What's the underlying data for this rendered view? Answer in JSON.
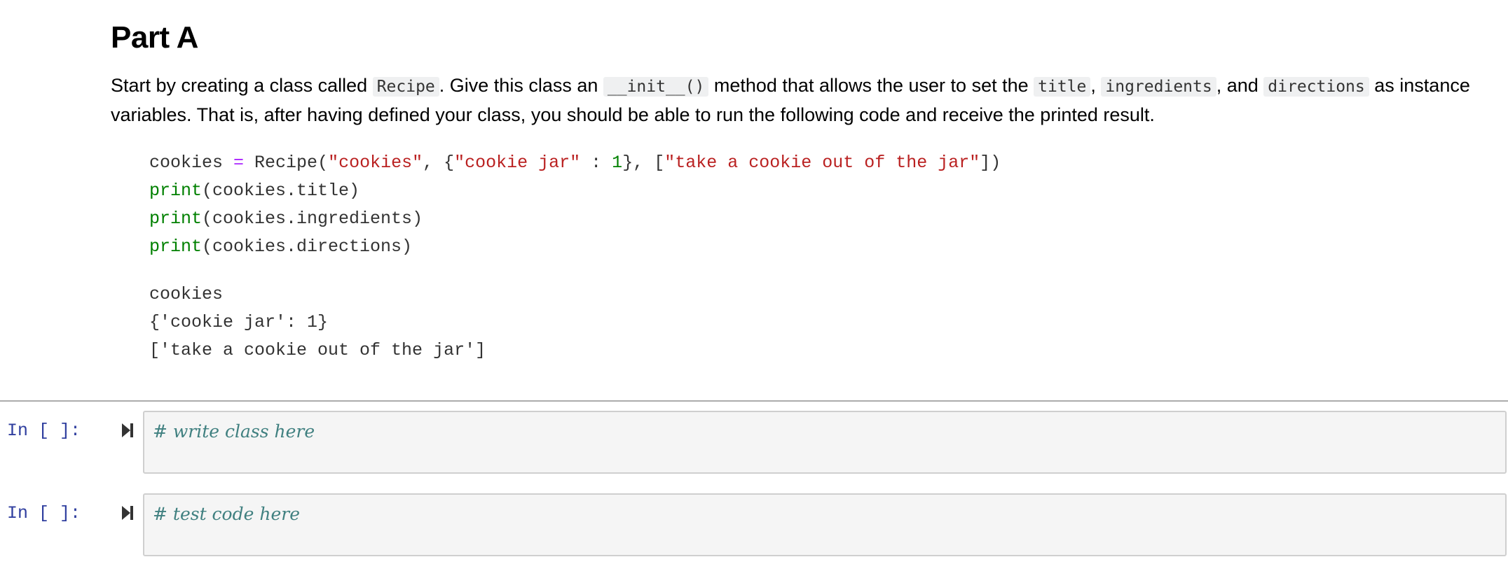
{
  "markdown": {
    "title": "Part A",
    "instructions": {
      "t1": "Start by creating a class called ",
      "c1": "Recipe",
      "t2": ". Give this class an ",
      "c2": "__init__()",
      "t3": " method that allows the user to set the ",
      "c3": "title",
      "t4": ", ",
      "c4": "ingredients",
      "t5": ", and ",
      "c5": "directions",
      "t6": " as instance variables. That is, after having defined your class, you should be able to run the following code and receive the printed result."
    },
    "example_code": {
      "line1": {
        "var": "cookies ",
        "op": "=",
        "call": " Recipe(",
        "s1": "\"cookies\"",
        "p1": ", {",
        "s2": "\"cookie jar\"",
        "p2": " : ",
        "n1": "1",
        "p3": "}, [",
        "s3": "\"take a cookie out of the jar\"",
        "p4": "])"
      },
      "line2": {
        "fn": "print",
        "args": "(cookies.title)"
      },
      "line3": {
        "fn": "print",
        "args": "(cookies.ingredients)"
      },
      "line4": {
        "fn": "print",
        "args": "(cookies.directions)"
      }
    },
    "example_output": [
      "cookies",
      "{'cookie jar': 1}",
      "['take a cookie out of the jar']"
    ]
  },
  "cells": [
    {
      "prompt": "In [ ]:",
      "code": "# write class here",
      "run_icon": "run-cell-icon"
    },
    {
      "prompt": "In [ ]:",
      "code": "# test code here",
      "run_icon": "run-cell-icon"
    }
  ],
  "colors": {
    "prompt": "#303f9f",
    "comment": "#408080",
    "string": "#ba2121",
    "number": "#008000",
    "builtin": "#008000",
    "operator": "#aa22ff",
    "editor_bg": "#f5f5f5",
    "inline_code_bg": "#eff0f1"
  }
}
